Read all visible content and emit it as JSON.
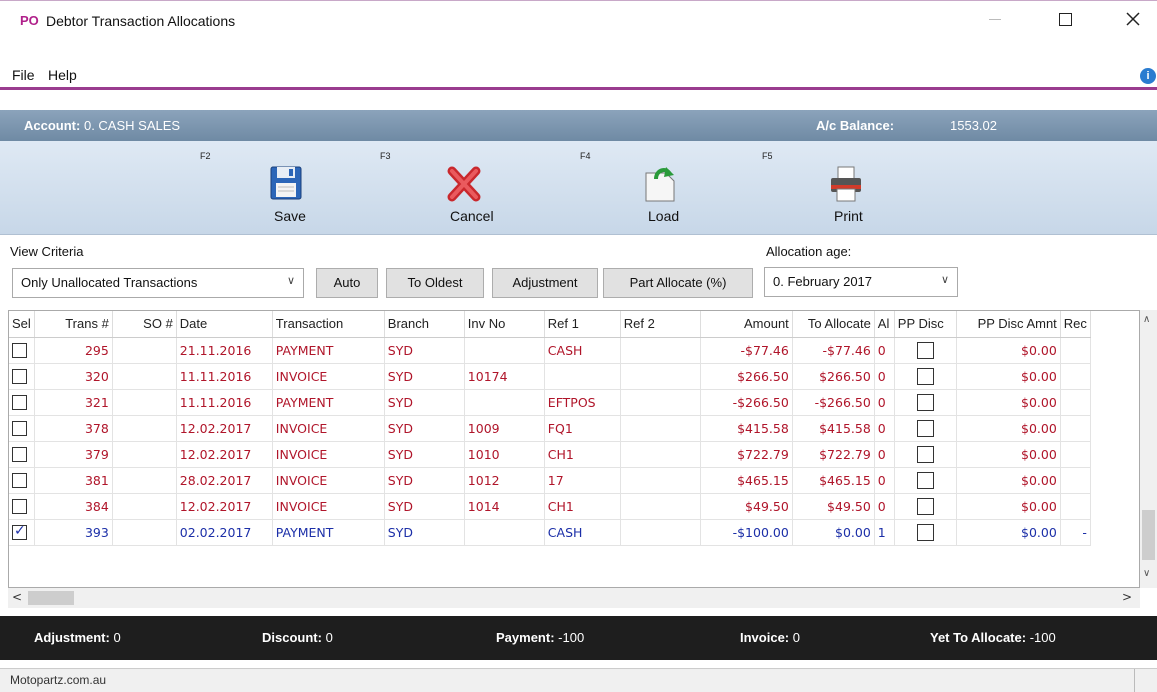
{
  "window": {
    "app_icon_text": "PO",
    "title": "Debtor Transaction Allocations"
  },
  "menu": {
    "file": "File",
    "help": "Help"
  },
  "account": {
    "label": "Account:",
    "value": "0. CASH SALES",
    "balance_label": "A/c Balance:",
    "balance_value": "1553.02"
  },
  "toolbar": {
    "save": {
      "fkey": "F2",
      "label": "Save",
      "icon": "floppy-disk-icon"
    },
    "cancel": {
      "fkey": "F3",
      "label": "Cancel",
      "icon": "red-x-icon"
    },
    "load": {
      "fkey": "F4",
      "label": "Load",
      "icon": "load-document-icon"
    },
    "print": {
      "fkey": "F5",
      "label": "Print",
      "icon": "printer-icon"
    }
  },
  "criteria": {
    "view_label": "View Criteria",
    "view_value": "Only Unallocated Transactions",
    "age_label": "Allocation age:",
    "age_value": "0. February 2017",
    "buttons": {
      "auto": "Auto",
      "to_oldest": "To Oldest",
      "adjustment": "Adjustment",
      "part_allocate": "Part Allocate (%)"
    }
  },
  "grid": {
    "headers": [
      "Sel",
      "Trans #",
      "SO #",
      "Date",
      "Transaction",
      "Branch",
      "Inv No",
      "Ref 1",
      "Ref 2",
      "Amount",
      "To Allocate",
      "Al",
      "PP Disc",
      "PP Disc Amnt",
      "Rec"
    ],
    "rows": [
      {
        "sel": false,
        "trans": "295",
        "so": "",
        "date": "21.11.2016",
        "transaction": "PAYMENT",
        "branch": "SYD",
        "inv": "",
        "ref1": "CASH",
        "ref2": "",
        "amount": "-$77.46",
        "to_allocate": "-$77.46",
        "al": "0",
        "pp_disc": false,
        "pp_disc_amnt": "$0.00",
        "rec": "",
        "color": "red"
      },
      {
        "sel": false,
        "trans": "320",
        "so": "",
        "date": "11.11.2016",
        "transaction": "INVOICE",
        "branch": "SYD",
        "inv": "10174",
        "ref1": "",
        "ref2": "",
        "amount": "$266.50",
        "to_allocate": "$266.50",
        "al": "0",
        "pp_disc": false,
        "pp_disc_amnt": "$0.00",
        "rec": "",
        "color": "red"
      },
      {
        "sel": false,
        "trans": "321",
        "so": "",
        "date": "11.11.2016",
        "transaction": "PAYMENT",
        "branch": "SYD",
        "inv": "",
        "ref1": "EFTPOS",
        "ref2": "",
        "amount": "-$266.50",
        "to_allocate": "-$266.50",
        "al": "0",
        "pp_disc": false,
        "pp_disc_amnt": "$0.00",
        "rec": "",
        "color": "red"
      },
      {
        "sel": false,
        "trans": "378",
        "so": "",
        "date": "12.02.2017",
        "transaction": "INVOICE",
        "branch": "SYD",
        "inv": "1009",
        "ref1": "FQ1",
        "ref2": "",
        "amount": "$415.58",
        "to_allocate": "$415.58",
        "al": "0",
        "pp_disc": false,
        "pp_disc_amnt": "$0.00",
        "rec": "",
        "color": "red"
      },
      {
        "sel": false,
        "trans": "379",
        "so": "",
        "date": "12.02.2017",
        "transaction": "INVOICE",
        "branch": "SYD",
        "inv": "1010",
        "ref1": "CH1",
        "ref2": "",
        "amount": "$722.79",
        "to_allocate": "$722.79",
        "al": "0",
        "pp_disc": false,
        "pp_disc_amnt": "$0.00",
        "rec": "",
        "color": "red"
      },
      {
        "sel": false,
        "trans": "381",
        "so": "",
        "date": "28.02.2017",
        "transaction": "INVOICE",
        "branch": "SYD",
        "inv": "1012",
        "ref1": "17",
        "ref2": "",
        "amount": "$465.15",
        "to_allocate": "$465.15",
        "al": "0",
        "pp_disc": false,
        "pp_disc_amnt": "$0.00",
        "rec": "",
        "color": "red"
      },
      {
        "sel": false,
        "trans": "384",
        "so": "",
        "date": "12.02.2017",
        "transaction": "INVOICE",
        "branch": "SYD",
        "inv": "1014",
        "ref1": "CH1",
        "ref2": "",
        "amount": "$49.50",
        "to_allocate": "$49.50",
        "al": "0",
        "pp_disc": false,
        "pp_disc_amnt": "$0.00",
        "rec": "",
        "color": "red"
      },
      {
        "sel": true,
        "trans": "393",
        "so": "",
        "date": "02.02.2017",
        "transaction": "PAYMENT",
        "branch": "SYD",
        "inv": "",
        "ref1": "CASH",
        "ref2": "",
        "amount": "-$100.00",
        "to_allocate": "$0.00",
        "al": "1",
        "pp_disc": false,
        "pp_disc_amnt": "$0.00",
        "rec": "-",
        "color": "blue"
      }
    ]
  },
  "summary": {
    "adjustment_label": "Adjustment:",
    "adjustment_value": "0",
    "discount_label": "Discount:",
    "discount_value": "0",
    "payment_label": "Payment:",
    "payment_value": "-100",
    "invoice_label": "Invoice:",
    "invoice_value": "0",
    "yet_label": "Yet To Allocate:",
    "yet_value": "-100"
  },
  "status": {
    "text": "Motopartz.com.au"
  },
  "colors": {
    "accent": "#9a3c8f",
    "account_bar": "#7d97b0",
    "row_red": "#b0152a",
    "row_blue": "#1c2fa8",
    "summary_bg": "#1e1e1e"
  }
}
